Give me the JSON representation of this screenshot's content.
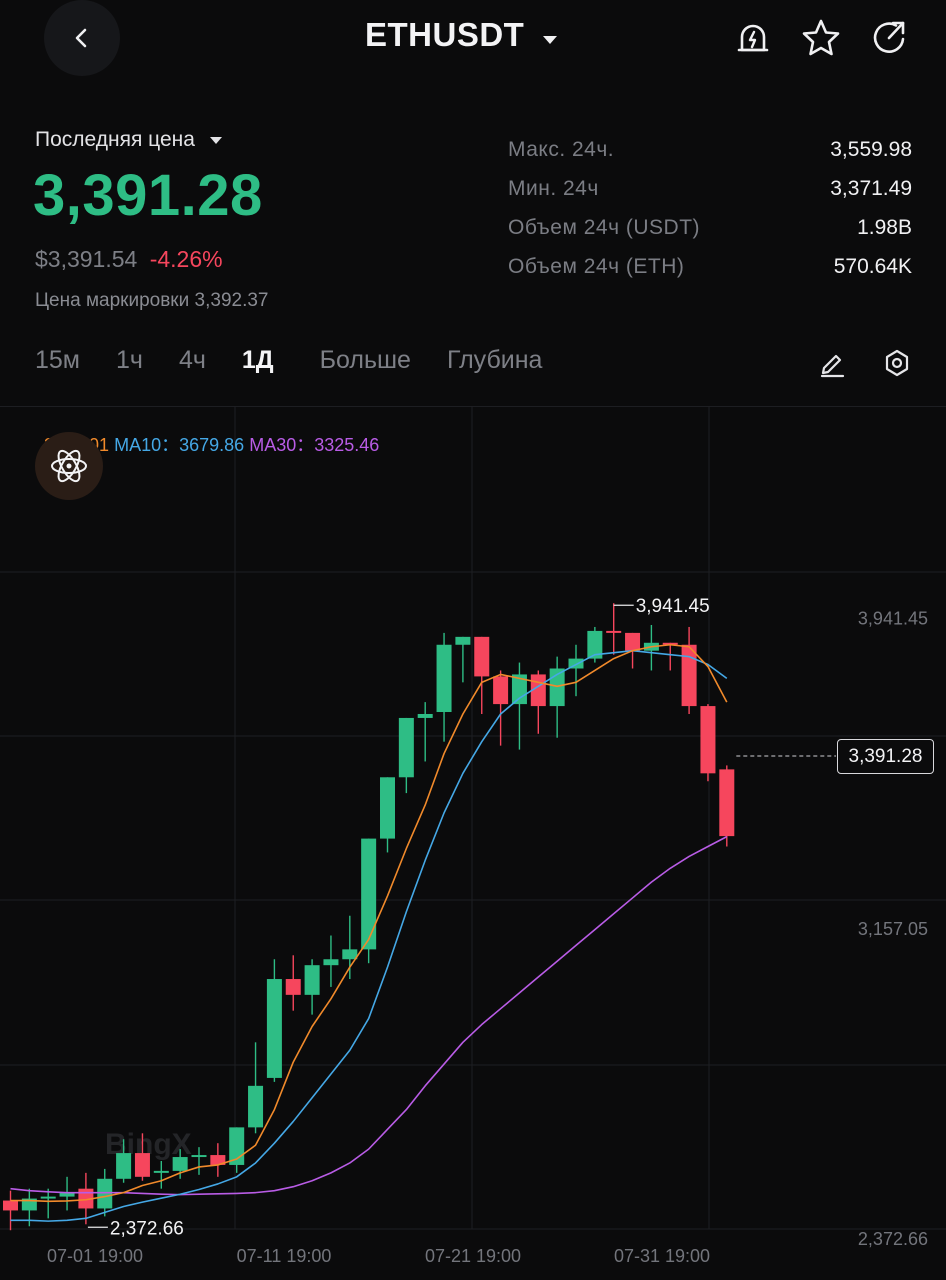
{
  "header": {
    "back_icon": "chevron-left-icon",
    "pair": "ETHUSDT",
    "pair_dropdown_icon": "caret-down-icon",
    "icons": [
      "price-alert-bell-icon",
      "star-icon",
      "share-icon"
    ]
  },
  "price_block": {
    "last_label": "Последняя цена",
    "last_price": "3,391.28",
    "usd_price": "$3,391.54",
    "change": "-4.26%",
    "mark_label": "Цена маркировки",
    "mark_price": "3,392.37",
    "colors": {
      "up": "#2ebd85",
      "down": "#f6465d"
    }
  },
  "stats": [
    {
      "label": "Макс. 24ч.",
      "value": "3,559.98"
    },
    {
      "label": "Мин. 24ч",
      "value": "3,371.49"
    },
    {
      "label": "Объем 24ч (USDT)",
      "value": "1.98B"
    },
    {
      "label": "Объем 24ч (ETH)",
      "value": "570.64K"
    }
  ],
  "tabs": {
    "items": [
      "15м",
      "1ч",
      "4ч",
      "1Д",
      "Больше",
      "Глубина"
    ],
    "active": "1Д",
    "tool_icons": [
      "pencil-draw-icon",
      "settings-hexagon-icon"
    ]
  },
  "ma_legend": {
    "ma5_value": "3609.01",
    "ma10_label": "MA10：",
    "ma10_value": "3679.86",
    "ma30_label": "MA30：",
    "ma30_value": "3325.46",
    "colors": {
      "ma5": "#f18a2b",
      "ma10": "#45a8e6",
      "ma30": "#b95ce6"
    }
  },
  "atom_icon": "atom-ai-icon",
  "watermark": "BingX",
  "current_price_tag": "3,391.28",
  "chart_data": {
    "type": "candlestick",
    "symbol": "ETHUSDT",
    "interval": "1Д",
    "y_axis_labels": [
      "3,941.45",
      "3,157.05",
      "2,372.66"
    ],
    "x_axis_labels": [
      "07-01 19:00",
      "07-11 19:00",
      "07-21 19:00",
      "07-31 19:00"
    ],
    "ylim": [
      2345,
      4155
    ],
    "high_marker": "3,941.45",
    "low_marker": "2,372.66",
    "last_price": 3391.28,
    "colors": {
      "up": "#2ebd85",
      "down": "#f6465d"
    },
    "candles": [
      {
        "o": 2470,
        "h": 2495,
        "l": 2395,
        "c": 2445
      },
      {
        "o": 2445,
        "h": 2500,
        "l": 2405,
        "c": 2475
      },
      {
        "o": 2475,
        "h": 2500,
        "l": 2425,
        "c": 2480
      },
      {
        "o": 2480,
        "h": 2530,
        "l": 2445,
        "c": 2490
      },
      {
        "o": 2500,
        "h": 2540,
        "l": 2410,
        "c": 2450
      },
      {
        "o": 2450,
        "h": 2550,
        "l": 2430,
        "c": 2525
      },
      {
        "o": 2525,
        "h": 2625,
        "l": 2515,
        "c": 2590
      },
      {
        "o": 2590,
        "h": 2640,
        "l": 2520,
        "c": 2530
      },
      {
        "o": 2540,
        "h": 2570,
        "l": 2500,
        "c": 2545
      },
      {
        "o": 2545,
        "h": 2600,
        "l": 2525,
        "c": 2580
      },
      {
        "o": 2580,
        "h": 2605,
        "l": 2535,
        "c": 2585
      },
      {
        "o": 2585,
        "h": 2615,
        "l": 2530,
        "c": 2560
      },
      {
        "o": 2560,
        "h": 2620,
        "l": 2540,
        "c": 2655
      },
      {
        "o": 2655,
        "h": 2870,
        "l": 2640,
        "c": 2760
      },
      {
        "o": 2780,
        "h": 3080,
        "l": 2770,
        "c": 3030
      },
      {
        "o": 3030,
        "h": 3090,
        "l": 2950,
        "c": 2990
      },
      {
        "o": 2990,
        "h": 3080,
        "l": 2940,
        "c": 3065
      },
      {
        "o": 3065,
        "h": 3140,
        "l": 3010,
        "c": 3080
      },
      {
        "o": 3080,
        "h": 3190,
        "l": 3030,
        "c": 3105
      },
      {
        "o": 3105,
        "h": 3330,
        "l": 3070,
        "c": 3385
      },
      {
        "o": 3385,
        "h": 3480,
        "l": 3350,
        "c": 3540
      },
      {
        "o": 3540,
        "h": 3640,
        "l": 3500,
        "c": 3690
      },
      {
        "o": 3690,
        "h": 3730,
        "l": 3580,
        "c": 3700
      },
      {
        "o": 3705,
        "h": 3905,
        "l": 3630,
        "c": 3875
      },
      {
        "o": 3875,
        "h": 3895,
        "l": 3780,
        "c": 3895
      },
      {
        "o": 3895,
        "h": 3880,
        "l": 3700,
        "c": 3795
      },
      {
        "o": 3795,
        "h": 3810,
        "l": 3620,
        "c": 3725
      },
      {
        "o": 3725,
        "h": 3830,
        "l": 3610,
        "c": 3800
      },
      {
        "o": 3800,
        "h": 3810,
        "l": 3650,
        "c": 3720
      },
      {
        "o": 3720,
        "h": 3845,
        "l": 3640,
        "c": 3815
      },
      {
        "o": 3815,
        "h": 3875,
        "l": 3745,
        "c": 3840
      },
      {
        "o": 3840,
        "h": 3920,
        "l": 3830,
        "c": 3910
      },
      {
        "o": 3910,
        "h": 3980,
        "l": 3850,
        "c": 3905
      },
      {
        "o": 3905,
        "h": 3895,
        "l": 3815,
        "c": 3860
      },
      {
        "o": 3860,
        "h": 3925,
        "l": 3810,
        "c": 3880
      },
      {
        "o": 3880,
        "h": 3875,
        "l": 3810,
        "c": 3875
      },
      {
        "o": 3875,
        "h": 3920,
        "l": 3700,
        "c": 3720
      },
      {
        "o": 3720,
        "h": 3725,
        "l": 3530,
        "c": 3550
      },
      {
        "o": 3560,
        "h": 3570,
        "l": 3365,
        "c": 3391.28
      }
    ],
    "ma5": [
      2470,
      2470,
      2468,
      2469,
      2472,
      2480,
      2490,
      2508,
      2520,
      2540,
      2555,
      2560,
      2575,
      2610,
      2700,
      2820,
      2910,
      2980,
      3060,
      3130,
      3240,
      3360,
      3470,
      3600,
      3700,
      3780,
      3800,
      3790,
      3780,
      3770,
      3780,
      3810,
      3840,
      3860,
      3870,
      3875,
      3870,
      3820,
      3730
    ],
    "ma10": [
      2420,
      2420,
      2418,
      2420,
      2425,
      2440,
      2455,
      2466,
      2476,
      2486,
      2498,
      2512,
      2530,
      2565,
      2615,
      2670,
      2730,
      2790,
      2850,
      2930,
      3060,
      3200,
      3330,
      3450,
      3550,
      3630,
      3700,
      3740,
      3770,
      3800,
      3825,
      3850,
      3855,
      3860,
      3855,
      3850,
      3845,
      3825,
      3790
    ],
    "ma30": [
      2500,
      2495,
      2492,
      2490,
      2490,
      2490,
      2490,
      2488,
      2486,
      2485,
      2486,
      2487,
      2488,
      2490,
      2495,
      2505,
      2520,
      2540,
      2565,
      2600,
      2650,
      2700,
      2760,
      2815,
      2870,
      2915,
      2955,
      2995,
      3035,
      3075,
      3115,
      3155,
      3195,
      3235,
      3275,
      3310,
      3340,
      3365,
      3390
    ]
  }
}
